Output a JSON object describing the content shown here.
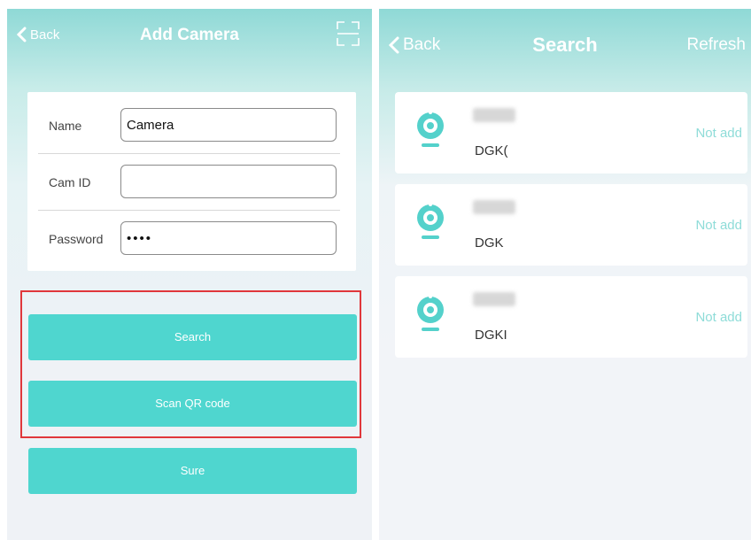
{
  "left_screen": {
    "nav": {
      "back_label": "Back",
      "title": "Add Camera"
    },
    "form": {
      "fields": [
        {
          "label": "Name",
          "value": "Camera"
        },
        {
          "label": "Cam ID",
          "value": ""
        },
        {
          "label": "Password",
          "value": "••••"
        }
      ]
    },
    "buttons": {
      "search": "Search",
      "scan_qr": "Scan QR code",
      "sure": "Sure"
    }
  },
  "right_screen": {
    "nav": {
      "back_label": "Back",
      "title": "Search",
      "refresh_label": "Refresh"
    },
    "cameras": [
      {
        "id": "DGK(",
        "status": "Not add"
      },
      {
        "id": "DGK",
        "status": "Not add"
      },
      {
        "id": "DGKI",
        "status": "Not add"
      }
    ]
  },
  "colors": {
    "accent": "#4fd6cf",
    "header_gradient_top": "#8fd9d6",
    "highlight_border": "#e0373b",
    "status_text": "#8edcd8"
  }
}
